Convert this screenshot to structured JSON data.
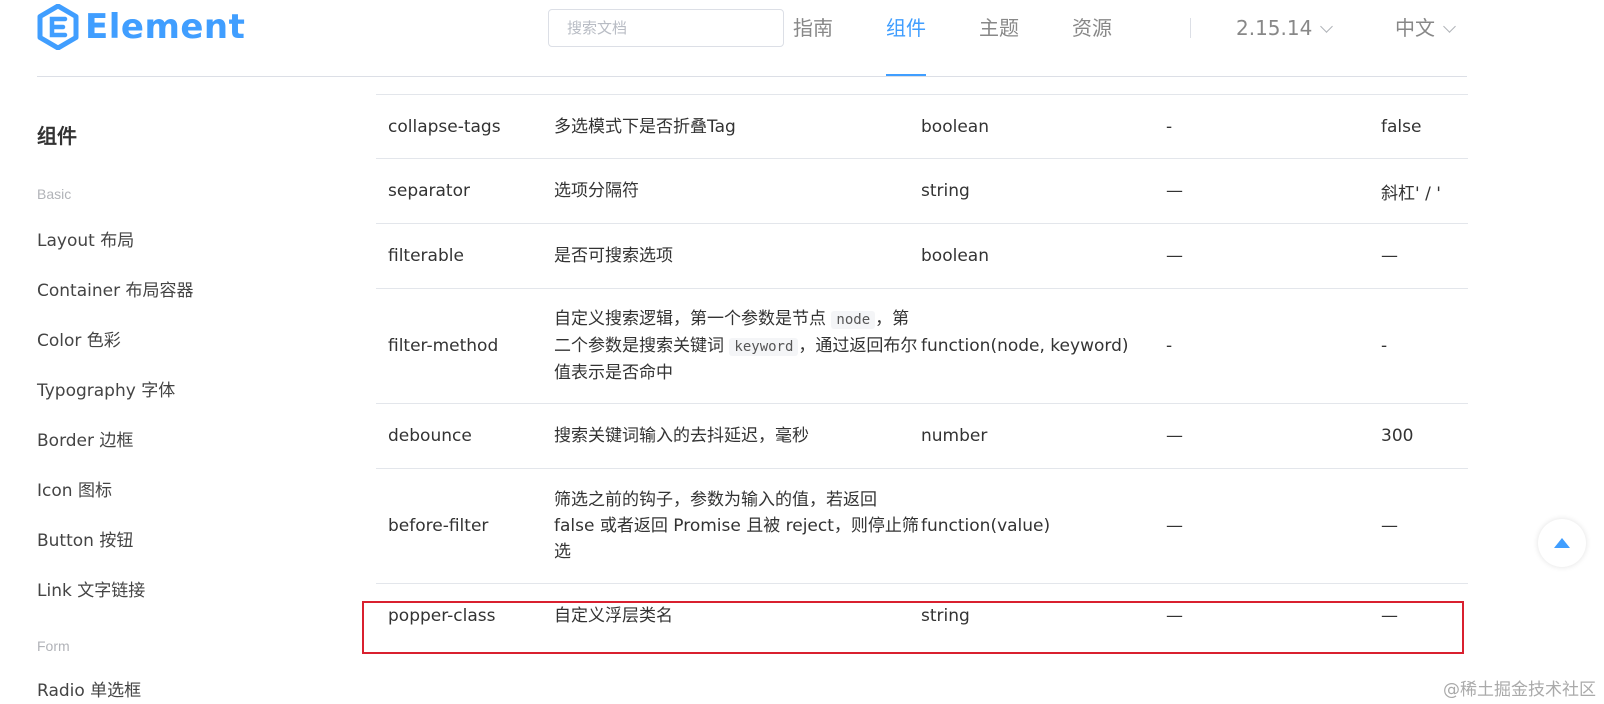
{
  "header": {
    "brand": "Element",
    "search_placeholder": "搜索文档",
    "nav": [
      {
        "label": "指南",
        "active": false
      },
      {
        "label": "组件",
        "active": true
      },
      {
        "label": "主题",
        "active": false
      },
      {
        "label": "资源",
        "active": false
      }
    ],
    "version": "2.15.14",
    "language": "中文",
    "accent_color": "#409eff"
  },
  "sidebar": {
    "title": "组件",
    "groups": [
      {
        "label": "Basic",
        "items": [
          "Layout 布局",
          "Container 布局容器",
          "Color 色彩",
          "Typography 字体",
          "Border 边框",
          "Icon 图标",
          "Button 按钮",
          "Link 文字链接"
        ]
      },
      {
        "label": "Form",
        "items": [
          "Radio 单选框"
        ]
      }
    ]
  },
  "table": {
    "rows": [
      {
        "param": "collapse-tags",
        "desc_parts": [
          {
            "text": "多选模式下是否折叠Tag"
          }
        ],
        "type": "boolean",
        "options": "-",
        "default": "false"
      },
      {
        "param": "separator",
        "desc_parts": [
          {
            "text": "选项分隔符"
          }
        ],
        "type": "string",
        "options": "—",
        "default": "斜杠' / '"
      },
      {
        "param": "filterable",
        "desc_parts": [
          {
            "text": "是否可搜索选项"
          }
        ],
        "type": "boolean",
        "options": "—",
        "default": "—"
      },
      {
        "param": "filter-method",
        "desc_parts": [
          {
            "text": "自定义搜索逻辑，第一个参数是节点 "
          },
          {
            "code": "node"
          },
          {
            "text": "，第二个参数是搜索关键词 "
          },
          {
            "code": "keyword"
          },
          {
            "text": "，通过返回布尔值表示是否命中"
          }
        ],
        "type": "function(node, keyword)",
        "options": "-",
        "default": "-"
      },
      {
        "param": "debounce",
        "desc_parts": [
          {
            "text": "搜索关键词输入的去抖延迟，毫秒"
          }
        ],
        "type": "number",
        "options": "—",
        "default": "300"
      },
      {
        "param": "before-filter",
        "desc_parts": [
          {
            "text": "筛选之前的钩子，参数为输入的值，若返回 false 或者返回 Promise 且被 reject，则停止筛选"
          }
        ],
        "type": "function(value)",
        "options": "—",
        "default": "—"
      },
      {
        "param": "popper-class",
        "desc_parts": [
          {
            "text": "自定义浮层类名"
          }
        ],
        "type": "string",
        "options": "—",
        "default": "—",
        "highlighted": true
      }
    ],
    "highlight_color": "#d9202f"
  },
  "watermark": "@稀土掘金技术社区"
}
